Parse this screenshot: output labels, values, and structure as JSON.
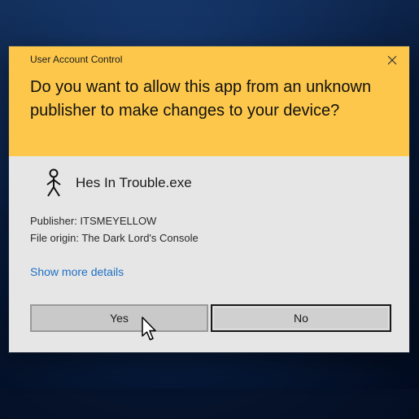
{
  "window": {
    "title": "User Account Control",
    "close_icon": "close-icon"
  },
  "prompt": {
    "question": "Do you want to allow this app from an unknown publisher to make changes to your device?",
    "header_color": "#fcc74a"
  },
  "app": {
    "icon": "stick-figure-icon",
    "name": "Hes In Trouble.exe",
    "publisher": "Publisher: ITSMEYELLOW",
    "origin": "File origin: The Dark Lord's Console"
  },
  "details_link": {
    "label": "Show more details",
    "color": "#1e6fc4"
  },
  "buttons": {
    "yes_label": "Yes",
    "no_label": "No"
  },
  "cursor": {
    "icon": "mouse-pointer-icon"
  }
}
